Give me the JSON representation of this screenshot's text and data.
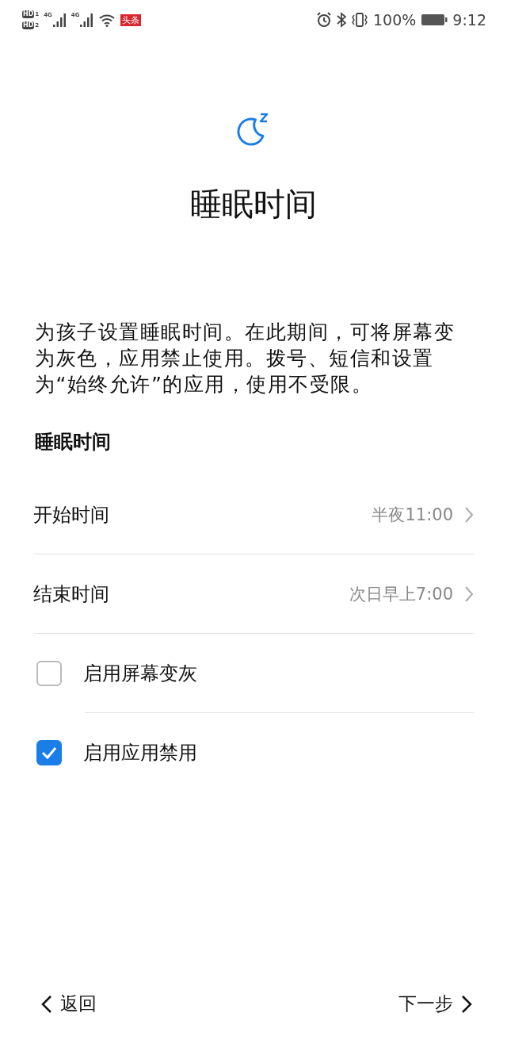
{
  "status_bar": {
    "sims": [
      {
        "label": "HD",
        "slot": "1",
        "network": "4G"
      },
      {
        "label": "HD",
        "slot": "2",
        "network": "4G"
      }
    ],
    "notification": "头条",
    "battery_text": "100%",
    "time": "9:12"
  },
  "title": "睡眠时间",
  "description": "为孩子设置睡眠时间。在此期间，可将屏幕变为灰色，应用禁止使用。拨号、短信和设置为“始终允许”的应用，使用不受限。",
  "section_header": "睡眠时间",
  "settings": [
    {
      "kind": "time",
      "label": "开始时间",
      "value": "半夜11:00"
    },
    {
      "kind": "time",
      "label": "结束时间",
      "value": "次日早上7:00"
    },
    {
      "kind": "checkbox",
      "label": "启用屏幕变灰",
      "checked": false
    },
    {
      "kind": "checkbox",
      "label": "启用应用禁用",
      "checked": true
    }
  ],
  "footer": {
    "back": "返回",
    "next": "下一步"
  }
}
